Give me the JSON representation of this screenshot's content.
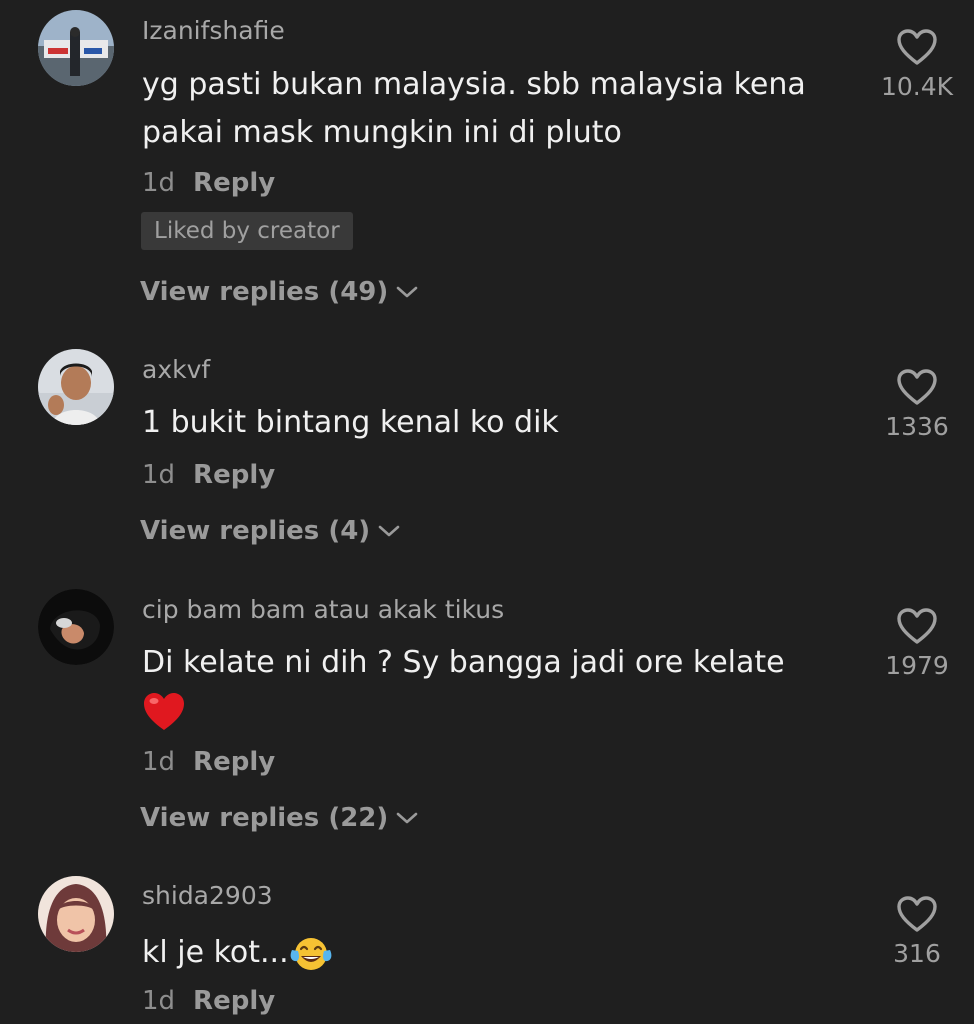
{
  "comments": [
    {
      "username": "Izanifshafie",
      "text": "yg pasti bukan malaysia. sbb malaysia kena pakai mask mungkin ini di pluto",
      "time": "1d",
      "reply_label": "Reply",
      "liked_badge": "Liked by creator",
      "view_replies": "View replies (49)",
      "likes": "10.4K"
    },
    {
      "username": "axkvf",
      "text": "1 bukit bintang kenal ko dik",
      "time": "1d",
      "reply_label": "Reply",
      "view_replies": "View replies (4)",
      "likes": "1336"
    },
    {
      "username": "cip bam bam atau akak tikus",
      "text": "Di kelate ni dih ? Sy bangga jadi ore kelate",
      "emoji": "heart-emoji",
      "time": "1d",
      "reply_label": "Reply",
      "view_replies": "View replies (22)",
      "likes": "1979"
    },
    {
      "username": "shida2903",
      "text": "kl je kot...",
      "emoji": "tears-of-joy-emoji",
      "time": "1d",
      "reply_label": "Reply",
      "likes": "316"
    }
  ],
  "icons": {
    "like": "heart-outline-icon",
    "expand": "chevron-down-icon"
  },
  "colors": {
    "background": "#1f1f1f",
    "text": "#f0f0f0",
    "secondary": "#a0a0a0",
    "badge": "#393939"
  }
}
